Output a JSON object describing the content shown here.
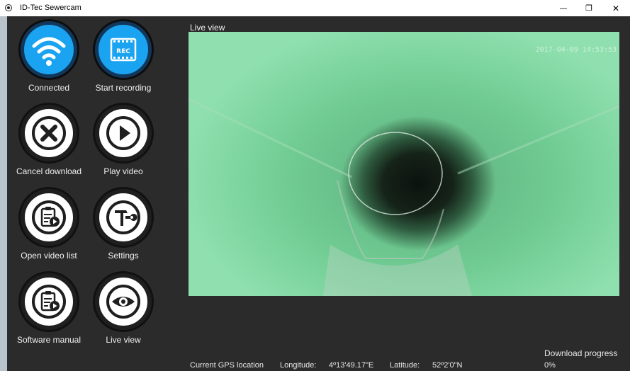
{
  "window": {
    "title": "ID-Tec Sewercam",
    "minimize_glyph": "—",
    "maximize_glyph": "❐",
    "close_glyph": "✕"
  },
  "sidebar": {
    "buttons": [
      {
        "label": "Connected",
        "icon": "wifi-icon",
        "style": "blue"
      },
      {
        "label": "Start recording",
        "icon": "rec-film-icon",
        "style": "blue",
        "icon_text": "REC"
      },
      {
        "label": "Cancel download",
        "icon": "x-icon",
        "style": "white"
      },
      {
        "label": "Play video",
        "icon": "play-icon",
        "style": "white"
      },
      {
        "label": "Open video list",
        "icon": "clipboard-play-icon",
        "style": "white"
      },
      {
        "label": "Settings",
        "icon": "hammer-wrench-icon",
        "style": "white"
      },
      {
        "label": "Software manual",
        "icon": "clipboard-play-icon",
        "style": "white"
      },
      {
        "label": "Live view",
        "icon": "eye-icon",
        "style": "white"
      }
    ]
  },
  "main": {
    "live_view_title": "Live view",
    "timestamp": "2017-04-09 14:53:53"
  },
  "status": {
    "gps_label": "Current GPS location",
    "longitude_label": "Longitude:",
    "longitude_value": "4º13'49.17\"E",
    "latitude_label": "Latitude:",
    "latitude_value": "52º2'0\"N",
    "download_label": "Download progress",
    "download_value": "0%",
    "download_progress": 0
  },
  "colors": {
    "accent_blue": "#1aa3f0",
    "background": "#2b2b2b",
    "video_green": "#6ec794"
  }
}
